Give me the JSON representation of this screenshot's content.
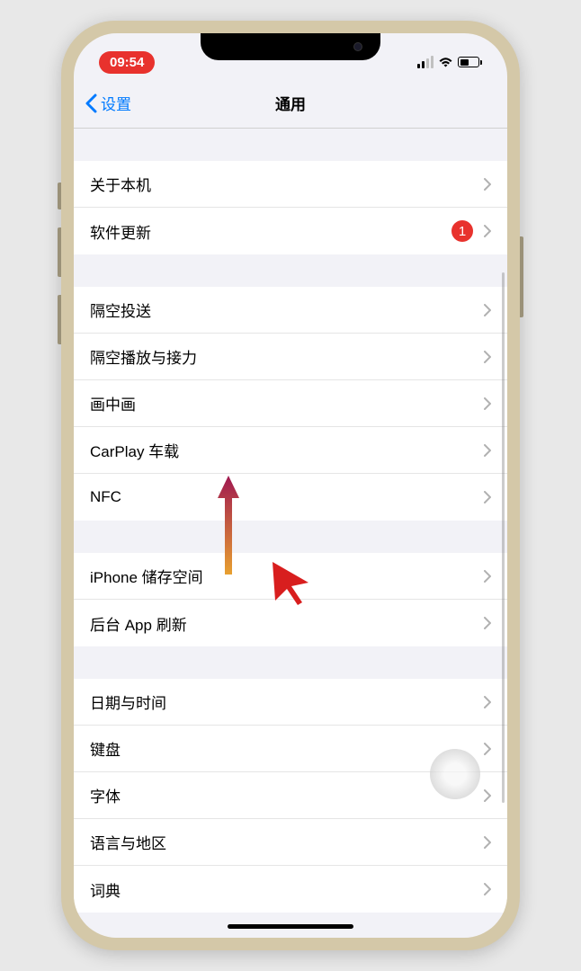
{
  "status": {
    "time": "09:54"
  },
  "nav": {
    "back_label": "设置",
    "title": "通用"
  },
  "sections": [
    {
      "cells": [
        {
          "label": "关于本机",
          "badge": null
        },
        {
          "label": "软件更新",
          "badge": "1"
        }
      ]
    },
    {
      "cells": [
        {
          "label": "隔空投送",
          "badge": null
        },
        {
          "label": "隔空播放与接力",
          "badge": null
        },
        {
          "label": "画中画",
          "badge": null
        },
        {
          "label": "CarPlay 车载",
          "badge": null
        },
        {
          "label": "NFC",
          "badge": null
        }
      ]
    },
    {
      "cells": [
        {
          "label": "iPhone 储存空间",
          "badge": null
        },
        {
          "label": "后台 App 刷新",
          "badge": null
        }
      ]
    },
    {
      "cells": [
        {
          "label": "日期与时间",
          "badge": null
        },
        {
          "label": "键盘",
          "badge": null
        },
        {
          "label": "字体",
          "badge": null
        },
        {
          "label": "语言与地区",
          "badge": null
        },
        {
          "label": "词典",
          "badge": null
        }
      ]
    }
  ]
}
